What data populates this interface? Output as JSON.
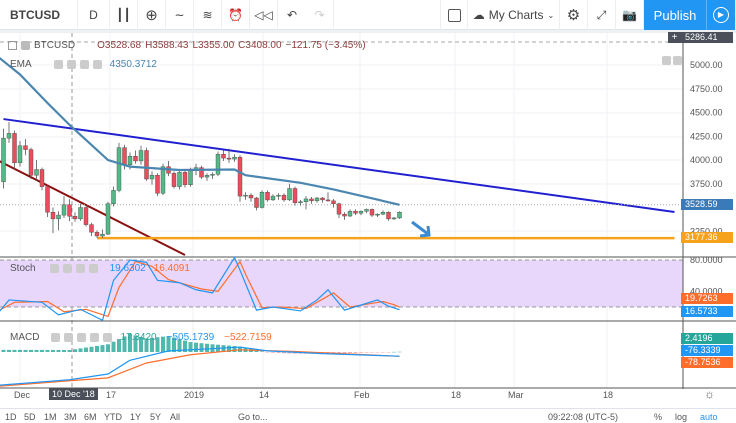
{
  "toolbar": {
    "symbol": "BTCUSD",
    "interval": "D",
    "my_charts": "My Charts",
    "publish": "Publish",
    "icons": [
      "candles-icon",
      "add-icon",
      "line-icon",
      "indicators-icon",
      "alert-icon",
      "replay-icon",
      "undo-icon",
      "redo-icon",
      "square-icon",
      "cloud-icon",
      "gear-icon",
      "fullscreen-icon",
      "camera-icon",
      "play-icon"
    ]
  },
  "legend": {
    "symbol": "BTCUSD",
    "open": "O3528.68",
    "high": "H3588.43",
    "low": "L3355.00",
    "close": "C3408.00",
    "change": "−121.75 (−3.45%)",
    "ema_label": "EMA",
    "ema_value": "4350.3712",
    "stoch_label": "Stoch",
    "stoch_k": "19.6302",
    "stoch_d": "16.4091",
    "macd_label": "MACD",
    "macd_hist": "17.3420",
    "macd_value": "−505.1739",
    "macd_signal": "−522.7159"
  },
  "price_axis": {
    "ticks": [
      "5000.00",
      "4750.00",
      "4500.00",
      "4250.00",
      "4000.00",
      "3750.00",
      "3250.00"
    ],
    "crosshair": "5286.41",
    "last": "3528.59",
    "support": "3177.36"
  },
  "stoch_axis": {
    "ticks": [
      "80.0000",
      "40.0000"
    ],
    "d_last": "19.7263",
    "k_last": "16.5733"
  },
  "macd_axis": {
    "hist_last": "2.4196",
    "macd_last": "-76.3339",
    "signal_last": "-78.7536"
  },
  "time_axis": {
    "labels": [
      "Dec",
      "17",
      "2019",
      "14",
      "Feb",
      "18",
      "Mar",
      "18"
    ],
    "crosshair": "10 Dec '18"
  },
  "bottom": {
    "ranges": [
      "1D",
      "5D",
      "1M",
      "3M",
      "6M",
      "YTD",
      "1Y",
      "5Y",
      "All"
    ],
    "goto": "Go to...",
    "clock": "09:22:08 (UTC-5)",
    "percent": "%",
    "log": "log",
    "auto": "auto"
  },
  "colors": {
    "up": "#53b987",
    "down": "#eb4d5c",
    "ema": "#4a86b0",
    "resistance": "#2020d0",
    "downtrend": "#8b1010",
    "support": "#f7a21b",
    "stoch_k": "#2196f3",
    "stoch_d": "#ff6d2d",
    "stoch_bg": "#e8d6fb",
    "publish": "#2196f3"
  },
  "chart_data": {
    "type": "candlestick",
    "symbol": "BTCUSD",
    "interval": "1D",
    "ohlc": [
      [
        "2018-11-28",
        3770,
        4330,
        3700,
        4230
      ],
      [
        "2018-11-29",
        4230,
        4400,
        4180,
        4280
      ],
      [
        "2018-11-30",
        4280,
        4310,
        3900,
        3970
      ],
      [
        "2018-12-01",
        3970,
        4200,
        3930,
        4150
      ],
      [
        "2018-12-02",
        4150,
        4220,
        4050,
        4110
      ],
      [
        "2018-12-03",
        4110,
        4130,
        3800,
        3840
      ],
      [
        "2018-12-04",
        3840,
        4000,
        3780,
        3900
      ],
      [
        "2018-12-05",
        3900,
        3920,
        3680,
        3720
      ],
      [
        "2018-12-06",
        3720,
        3740,
        3400,
        3450
      ],
      [
        "2018-12-07",
        3450,
        3500,
        3230,
        3380
      ],
      [
        "2018-12-08",
        3380,
        3460,
        3260,
        3420
      ],
      [
        "2018-12-09",
        3420,
        3620,
        3390,
        3528.68
      ],
      [
        "2018-12-10",
        3528.68,
        3588.43,
        3355,
        3408
      ],
      [
        "2018-12-11",
        3408,
        3450,
        3350,
        3380
      ],
      [
        "2018-12-12",
        3380,
        3540,
        3360,
        3500
      ],
      [
        "2018-12-13",
        3500,
        3510,
        3300,
        3320
      ],
      [
        "2018-12-14",
        3320,
        3340,
        3200,
        3240
      ],
      [
        "2018-12-15",
        3240,
        3260,
        3180,
        3200
      ],
      [
        "2018-12-16",
        3200,
        3270,
        3180,
        3220
      ],
      [
        "2018-12-17",
        3220,
        3560,
        3210,
        3540
      ],
      [
        "2018-12-18",
        3540,
        3720,
        3510,
        3680
      ],
      [
        "2018-12-19",
        3680,
        4180,
        3660,
        4130
      ],
      [
        "2018-12-20",
        4130,
        4160,
        3900,
        3950
      ],
      [
        "2018-12-21",
        3950,
        4080,
        3900,
        4040
      ],
      [
        "2018-12-22",
        4040,
        4100,
        3960,
        3990
      ],
      [
        "2018-12-23",
        3990,
        4150,
        3950,
        4100
      ],
      [
        "2018-12-24",
        4100,
        4130,
        3780,
        3800
      ],
      [
        "2018-12-25",
        3800,
        3880,
        3740,
        3840
      ],
      [
        "2018-12-26",
        3840,
        3860,
        3620,
        3650
      ],
      [
        "2018-12-27",
        3650,
        3960,
        3630,
        3930
      ],
      [
        "2018-12-28",
        3930,
        3990,
        3830,
        3860
      ],
      [
        "2018-12-29",
        3860,
        3880,
        3700,
        3720
      ],
      [
        "2018-12-30",
        3720,
        3900,
        3690,
        3870
      ],
      [
        "2018-12-31",
        3870,
        3890,
        3710,
        3740
      ],
      [
        "2019-01-01",
        3740,
        3920,
        3720,
        3890
      ],
      [
        "2019-01-02",
        3890,
        3960,
        3840,
        3920
      ],
      [
        "2019-01-03",
        3920,
        3940,
        3800,
        3820
      ],
      [
        "2019-01-04",
        3820,
        3860,
        3780,
        3840
      ],
      [
        "2019-01-05",
        3840,
        3870,
        3800,
        3850
      ],
      [
        "2019-01-06",
        3850,
        4090,
        3830,
        4060
      ],
      [
        "2019-01-07",
        4060,
        4100,
        3990,
        4020
      ],
      [
        "2019-01-08",
        4020,
        4120,
        3970,
        4010
      ],
      [
        "2019-01-09",
        4010,
        4060,
        3980,
        4030
      ],
      [
        "2019-01-10",
        4030,
        4050,
        3560,
        3620
      ],
      [
        "2019-01-11",
        3620,
        3660,
        3580,
        3630
      ],
      [
        "2019-01-12",
        3630,
        3650,
        3560,
        3600
      ],
      [
        "2019-01-13",
        3600,
        3610,
        3470,
        3500
      ],
      [
        "2019-01-14",
        3500,
        3680,
        3490,
        3660
      ],
      [
        "2019-01-15",
        3660,
        3680,
        3560,
        3580
      ],
      [
        "2019-01-16",
        3580,
        3640,
        3570,
        3620
      ],
      [
        "2019-01-17",
        3620,
        3650,
        3580,
        3630
      ],
      [
        "2019-01-18",
        3630,
        3650,
        3560,
        3580
      ],
      [
        "2019-01-19",
        3580,
        3750,
        3570,
        3700
      ],
      [
        "2019-01-20",
        3700,
        3720,
        3520,
        3550
      ],
      [
        "2019-01-21",
        3550,
        3580,
        3520,
        3560
      ],
      [
        "2019-01-22",
        3560,
        3620,
        3480,
        3590
      ],
      [
        "2019-01-23",
        3590,
        3610,
        3540,
        3570
      ],
      [
        "2019-01-24",
        3570,
        3610,
        3550,
        3600
      ],
      [
        "2019-01-25",
        3600,
        3610,
        3550,
        3580
      ],
      [
        "2019-01-26",
        3580,
        3660,
        3560,
        3570
      ],
      [
        "2019-01-27",
        3570,
        3590,
        3500,
        3540
      ],
      [
        "2019-01-28",
        3540,
        3550,
        3390,
        3430
      ],
      [
        "2019-01-29",
        3430,
        3450,
        3370,
        3410
      ],
      [
        "2019-01-30",
        3410,
        3480,
        3400,
        3460
      ],
      [
        "2019-01-31",
        3460,
        3480,
        3420,
        3440
      ],
      [
        "2019-02-01",
        3440,
        3470,
        3420,
        3460
      ],
      [
        "2019-02-02",
        3460,
        3490,
        3440,
        3480
      ],
      [
        "2019-02-03",
        3480,
        3490,
        3400,
        3420
      ],
      [
        "2019-02-04",
        3420,
        3440,
        3400,
        3430
      ],
      [
        "2019-02-05",
        3430,
        3470,
        3420,
        3450
      ],
      [
        "2019-02-06",
        3450,
        3460,
        3360,
        3380
      ],
      [
        "2019-02-07",
        3380,
        3400,
        3370,
        3390
      ],
      [
        "2019-02-08",
        3390,
        3460,
        3380,
        3450
      ]
    ],
    "ema": [
      [
        "2018-11-25",
        5180
      ],
      [
        "2018-12-01",
        4900
      ],
      [
        "2018-12-06",
        4600
      ],
      [
        "2018-12-10",
        4370
      ],
      [
        "2018-12-17",
        4000
      ],
      [
        "2018-12-21",
        3930
      ],
      [
        "2018-12-30",
        3895
      ],
      [
        "2019-01-09",
        3900
      ],
      [
        "2019-01-11",
        3840
      ],
      [
        "2019-01-21",
        3760
      ],
      [
        "2019-01-27",
        3690
      ],
      [
        "2019-02-02",
        3610
      ],
      [
        "2019-02-08",
        3528.59
      ]
    ],
    "trendlines": [
      {
        "from": [
          "2018-11-28",
          4431
        ],
        "to": [
          "2019-03-30",
          3453
        ],
        "color": "resistance"
      },
      {
        "from": [
          "2018-11-25",
          4053
        ],
        "to": [
          "2018-12-31",
          3000
        ],
        "color": "downtrend"
      },
      {
        "from": [
          "2018-12-15",
          3177.36
        ],
        "to": [
          "2019-03-30",
          3177.36
        ],
        "color": "support"
      }
    ],
    "stoch": {
      "k": [
        [
          "2018-11-27",
          12
        ],
        [
          "2018-11-29",
          29
        ],
        [
          "2018-12-05",
          26
        ],
        [
          "2018-12-08",
          10
        ],
        [
          "2018-12-12",
          17
        ],
        [
          "2018-12-16",
          3
        ],
        [
          "2018-12-18",
          54
        ],
        [
          "2018-12-21",
          80
        ],
        [
          "2018-12-24",
          77
        ],
        [
          "2018-12-26",
          54
        ],
        [
          "2018-12-30",
          51
        ],
        [
          "2019-01-02",
          42
        ],
        [
          "2019-01-05",
          38
        ],
        [
          "2019-01-09",
          83
        ],
        [
          "2019-01-10",
          67
        ],
        [
          "2019-01-13",
          16
        ],
        [
          "2019-01-16",
          20
        ],
        [
          "2019-01-21",
          15
        ],
        [
          "2019-01-24",
          29
        ],
        [
          "2019-01-26",
          42
        ],
        [
          "2019-01-29",
          16
        ],
        [
          "2019-02-04",
          29
        ],
        [
          "2019-02-06",
          21
        ],
        [
          "2019-02-08",
          16.57
        ]
      ],
      "d": [
        [
          "2018-11-27",
          15
        ],
        [
          "2018-11-30",
          26
        ],
        [
          "2018-12-06",
          27
        ],
        [
          "2018-12-09",
          14
        ],
        [
          "2018-12-13",
          17
        ],
        [
          "2018-12-17",
          8
        ],
        [
          "2018-12-19",
          45
        ],
        [
          "2018-12-22",
          78
        ],
        [
          "2018-12-25",
          72
        ],
        [
          "2018-12-28",
          55
        ],
        [
          "2018-12-31",
          49
        ],
        [
          "2019-01-03",
          43
        ],
        [
          "2019-01-06",
          40
        ],
        [
          "2019-01-10",
          78
        ],
        [
          "2019-01-11",
          62
        ],
        [
          "2019-01-14",
          19
        ],
        [
          "2019-01-17",
          20
        ],
        [
          "2019-01-22",
          18
        ],
        [
          "2019-01-25",
          30
        ],
        [
          "2019-01-27",
          38
        ],
        [
          "2019-01-30",
          20
        ],
        [
          "2019-02-05",
          27
        ],
        [
          "2019-02-07",
          23
        ],
        [
          "2019-02-08",
          19.73
        ]
      ],
      "levels": [
        80,
        20
      ]
    },
    "macd": {
      "macd": [
        [
          "2018-11-25",
          -620
        ],
        [
          "2018-12-10",
          -505
        ],
        [
          "2018-12-17",
          -400
        ],
        [
          "2018-12-21",
          -150
        ],
        [
          "2018-12-28",
          20
        ],
        [
          "2019-01-05",
          60
        ],
        [
          "2019-01-10",
          90
        ],
        [
          "2019-01-15",
          20
        ],
        [
          "2019-01-25",
          -30
        ],
        [
          "2019-02-08",
          -76.33
        ]
      ],
      "signal": [
        [
          "2018-11-25",
          -640
        ],
        [
          "2018-12-10",
          -523
        ],
        [
          "2018-12-17",
          -470
        ],
        [
          "2018-12-24",
          -200
        ],
        [
          "2019-01-01",
          -50
        ],
        [
          "2019-01-10",
          40
        ],
        [
          "2019-01-20",
          10
        ],
        [
          "2019-02-08",
          -78.75
        ]
      ]
    },
    "xlabels": [
      "Dec",
      "17",
      "2019",
      "14",
      "Feb",
      "18",
      "Mar",
      "18"
    ]
  }
}
